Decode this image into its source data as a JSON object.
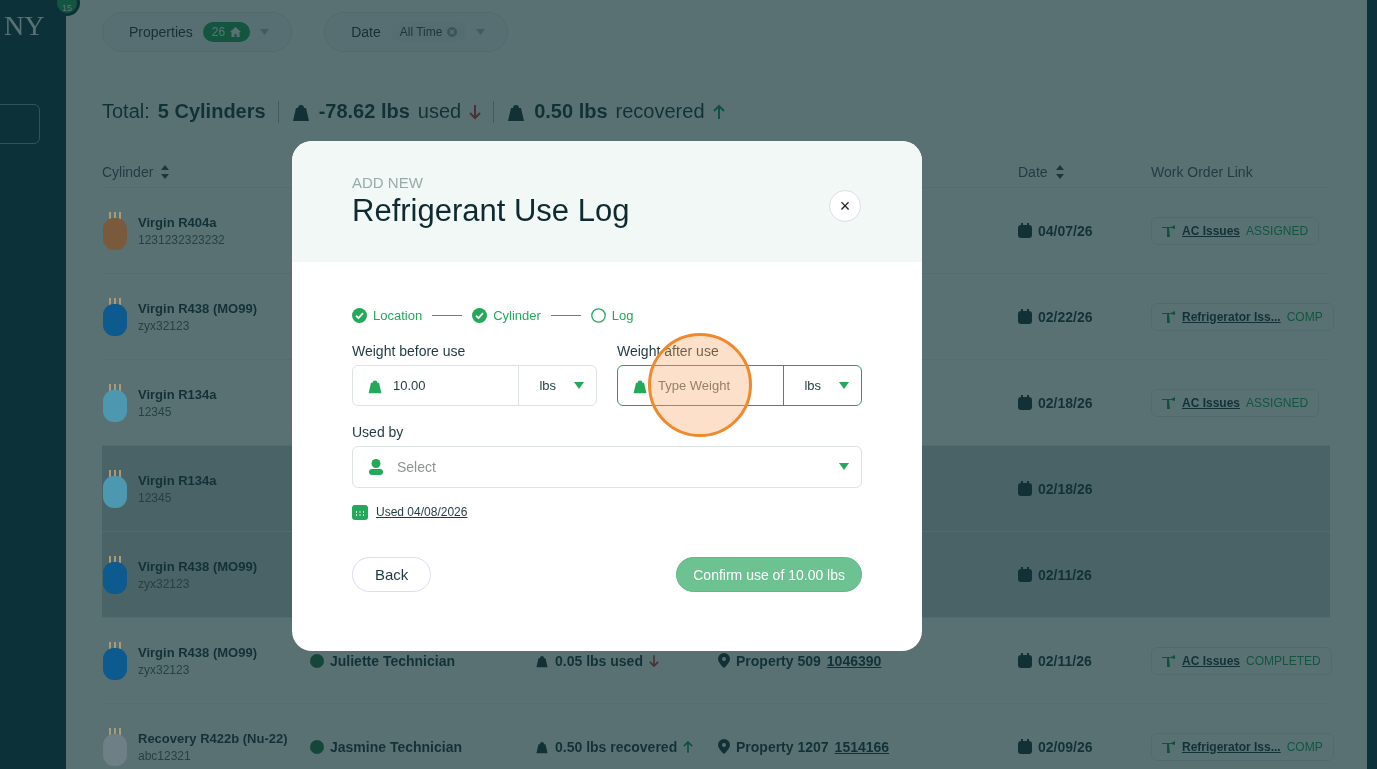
{
  "sidebar": {
    "logo_text": "NY",
    "badge": "15"
  },
  "filters": [
    {
      "label": "Properties",
      "chip": "26",
      "kind": "count"
    },
    {
      "label": "Date",
      "chip": "All Time",
      "kind": "clearable"
    }
  ],
  "totals": {
    "label": "Total:",
    "cylinders": "5 Cylinders",
    "used_value": "-78.62 lbs",
    "used_label": "used",
    "recovered_value": "0.50 lbs",
    "recovered_label": "recovered"
  },
  "table": {
    "columns": [
      {
        "label": "Cylinder",
        "kind": "cylinder",
        "sortable": true
      },
      {
        "label": "Date",
        "kind": "date",
        "sortable": true
      },
      {
        "label": "Work Order Link",
        "kind": "work_order",
        "sortable": false
      }
    ],
    "rows": [
      {
        "name": "Virgin R404a",
        "serial": "1231232323232",
        "color": "#7a5a3c",
        "selected": false,
        "date": "04/07/26",
        "work_order": {
          "title": "AC Issues",
          "status": "ASSIGNED"
        }
      },
      {
        "name": "Virgin R438 (MO99)",
        "serial": "zyx32123",
        "color": "#0d5a8f",
        "selected": false,
        "date": "02/22/26",
        "work_order": {
          "title": "Refrigerator Iss...",
          "status": "COMP"
        }
      },
      {
        "name": "Virgin R134a",
        "serial": "12345",
        "color": "#4d98b0",
        "selected": false,
        "date": "02/18/26",
        "work_order": {
          "title": "AC Issues",
          "status": "ASSIGNED"
        }
      },
      {
        "name": "Virgin R134a",
        "serial": "12345",
        "color": "#4d98b0",
        "selected": true,
        "date": "02/18/26"
      },
      {
        "name": "Virgin R438 (MO99)",
        "serial": "zyx32123",
        "color": "#0d5a8f",
        "selected": true,
        "date": "02/11/26"
      },
      {
        "name": "Virgin R438 (MO99)",
        "serial": "zyx32123",
        "color": "#0d5a8f",
        "selected": false,
        "technician": "Juliette Technician",
        "amount": {
          "text": "0.05 lbs used",
          "kind": "used"
        },
        "property": {
          "name": "Property 509",
          "code": "1046390"
        },
        "date": "02/11/26",
        "work_order": {
          "title": "AC Issues",
          "status": "COMPLETED"
        }
      },
      {
        "name": "Recovery R422b (Nu-22)",
        "serial": "abc12321",
        "color": "#6e7f85",
        "selected": false,
        "technician": "Jasmine Technician",
        "amount": {
          "text": "0.50 lbs recovered",
          "kind": "recovered"
        },
        "property": {
          "name": "Property 1207",
          "code": "1514166"
        },
        "date": "02/09/26",
        "work_order": {
          "title": "Refrigerator Iss...",
          "status": "COMP"
        }
      }
    ]
  },
  "modal": {
    "eyebrow": "ADD NEW",
    "title": "Refrigerant Use Log",
    "close": "×",
    "steps": [
      {
        "label": "Location",
        "done": true
      },
      {
        "label": "Cylinder",
        "done": true
      },
      {
        "label": "Log",
        "done": false
      }
    ],
    "weight_before": {
      "label": "Weight before use",
      "value": "10.00",
      "unit": "lbs",
      "focused": false
    },
    "weight_after": {
      "label": "Weight after use",
      "placeholder": "Type Weight",
      "unit": "lbs",
      "focused": true
    },
    "used_by": {
      "label": "Used by",
      "placeholder": "Select"
    },
    "date_link": "Used 04/08/2026",
    "back": "Back",
    "confirm": {
      "label": "Confirm use of 10.00 lbs",
      "disabled": true
    }
  }
}
